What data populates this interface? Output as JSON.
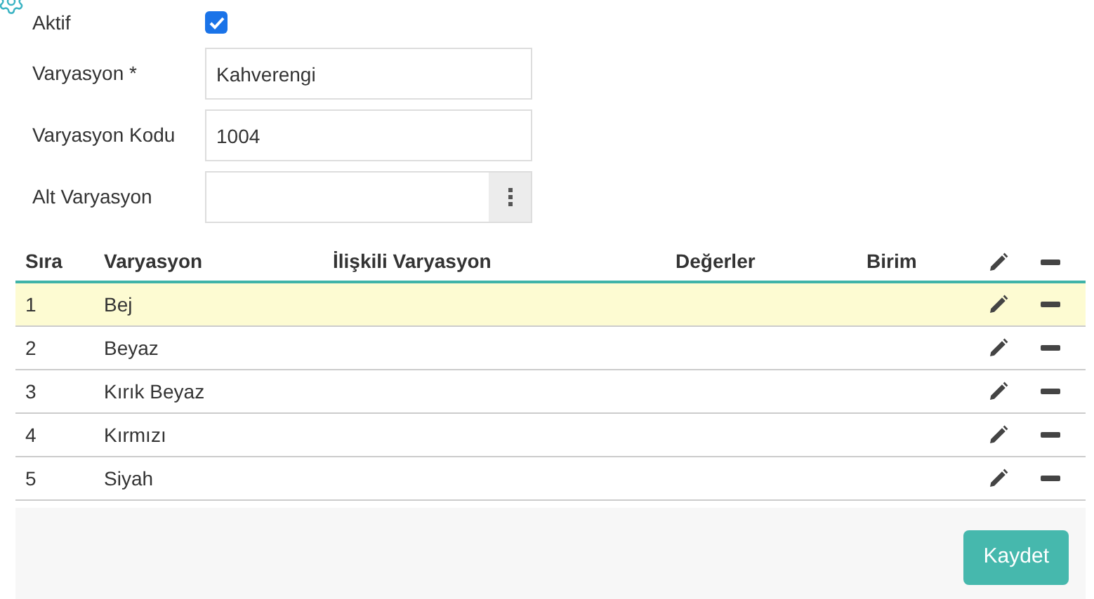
{
  "form": {
    "active": {
      "label": "Aktif",
      "checked": true
    },
    "fields": [
      {
        "label": "Varyasyon *",
        "value": "Kahverengi",
        "kind": "text"
      },
      {
        "label": "Varyasyon Kodu",
        "value": "1004",
        "kind": "text"
      },
      {
        "label": "Alt Varyasyon",
        "kind": "picker"
      }
    ]
  },
  "table": {
    "columns": [
      "Sıra",
      "Varyasyon",
      "İlişkili Varyasyon",
      "Değerler",
      "Birim"
    ],
    "rows": [
      {
        "cells": [
          "1",
          "Bej"
        ],
        "selected": true
      },
      {
        "cells": [
          "2",
          "Beyaz"
        ],
        "selected": false
      },
      {
        "cells": [
          "3",
          "Kırık Beyaz"
        ],
        "selected": false
      },
      {
        "cells": [
          "4",
          "Kırmızı"
        ],
        "selected": false
      },
      {
        "cells": [
          "5",
          "Siyah"
        ],
        "selected": false
      }
    ]
  },
  "save_button": "Kaydet"
}
